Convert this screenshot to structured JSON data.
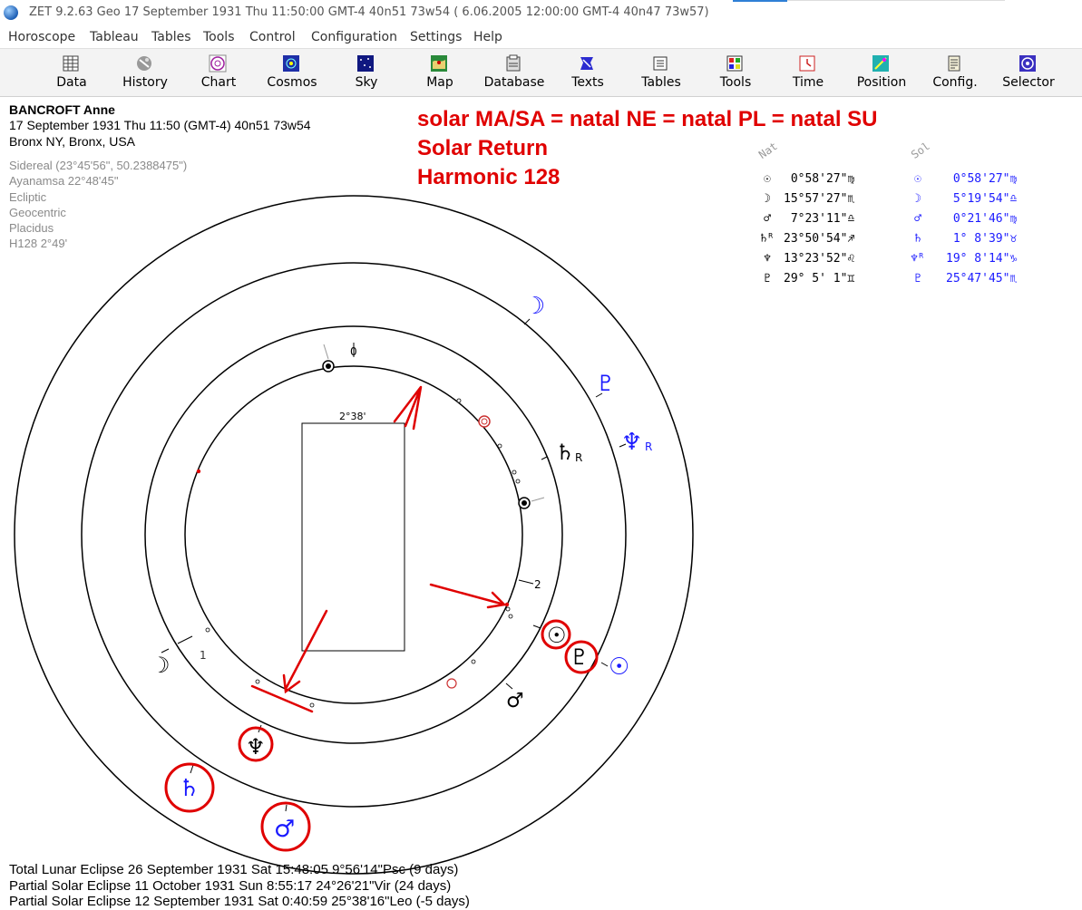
{
  "window": {
    "title": "ZET 9.2.63 Geo    17 September 1931  Thu  11:50:00 GMT-4 40n51  73w54   ( 6.06.2005  12:00:00 GMT-4 40n47 73w57)"
  },
  "menu": [
    "Horoscope",
    "Tableau",
    "Tables",
    "Tools",
    "Control",
    "Configuration",
    "Settings",
    "Help"
  ],
  "toolbar": [
    {
      "label": "Data",
      "icon": "data-grid-icon"
    },
    {
      "label": "History",
      "icon": "history-icon"
    },
    {
      "label": "Chart",
      "icon": "chart-wheel-icon"
    },
    {
      "label": "Cosmos",
      "icon": "cosmos-icon"
    },
    {
      "label": "Sky",
      "icon": "sky-icon"
    },
    {
      "label": "Map",
      "icon": "map-icon"
    },
    {
      "label": "Database",
      "icon": "database-icon"
    },
    {
      "label": "Texts",
      "icon": "texts-icon"
    },
    {
      "label": "Tables",
      "icon": "tables-icon"
    },
    {
      "label": "Tools",
      "icon": "tools-icon"
    },
    {
      "label": "Time",
      "icon": "time-icon"
    },
    {
      "label": "Position",
      "icon": "position-icon"
    },
    {
      "label": "Config.",
      "icon": "config-icon"
    },
    {
      "label": "Selector",
      "icon": "selector-icon"
    }
  ],
  "person": {
    "name": "BANCROFT Anne",
    "datetime": "17 September 1931  Thu  11:50 (GMT-4) 40n51  73w54",
    "place": "Bronx NY, Bronx, USA"
  },
  "settings": [
    "Sidereal (23°45'56\", 50.2388475\")",
    "Ayanamsa 22°48'45\"",
    "Ecliptic",
    "Geocentric",
    "Placidus",
    "H128   2°49'"
  ],
  "annotation": [
    "solar MA/SA = natal NE = natal PL = natal SU",
    "Solar Return",
    "Harmonic 128"
  ],
  "table": {
    "nat_header": "Nat",
    "sol_header": "Sol",
    "rows": [
      {
        "nat_glyph": "☉",
        "nat_value": " 0°58'27\"♍",
        "sol_glyph": "☉",
        "sol_value": " 0°58'27\"♍"
      },
      {
        "nat_glyph": "☽",
        "nat_value": "15°57'27\"♏",
        "sol_glyph": "☽",
        "sol_value": " 5°19'54\"♎"
      },
      {
        "nat_glyph": "♂",
        "nat_value": " 7°23'11\"♎",
        "sol_glyph": "♂",
        "sol_value": " 0°21'46\"♍"
      },
      {
        "nat_glyph": "♄ᴿ",
        "nat_value": "23°50'54\"♐",
        "sol_glyph": "♄",
        "sol_value": " 1° 8'39\"♉"
      },
      {
        "nat_glyph": "♆",
        "nat_value": "13°23'52\"♌",
        "sol_glyph": "♆ᴿ",
        "sol_value": "19° 8'14\"♑"
      },
      {
        "nat_glyph": "♇",
        "nat_value": "29° 5' 1\"♊",
        "sol_glyph": "♇",
        "sol_value": "25°47'45\"♏"
      }
    ]
  },
  "wheel": {
    "box_label": "2°38'",
    "house_labels": [
      "0",
      "1",
      "2"
    ],
    "natal_planets": [
      {
        "name": "moon",
        "glyph": "☽"
      },
      {
        "name": "mars",
        "glyph": "♂"
      },
      {
        "name": "saturn",
        "glyph": "♄"
      },
      {
        "name": "neptune",
        "glyph": "♆"
      },
      {
        "name": "pluto",
        "glyph": "♇"
      },
      {
        "name": "sun",
        "glyph": "☉"
      }
    ],
    "solar_planets": [
      {
        "name": "moon",
        "glyph": "☽"
      },
      {
        "name": "pluto",
        "glyph": "♇"
      },
      {
        "name": "neptune",
        "glyph": "♆"
      },
      {
        "name": "sun",
        "glyph": "☉"
      },
      {
        "name": "saturn",
        "glyph": "♄"
      },
      {
        "name": "mars",
        "glyph": "♂"
      }
    ],
    "retrograde_mark": "R",
    "colors": {
      "natal": "#000000",
      "solar": "#1a1aff",
      "annotation": "#e00000"
    }
  },
  "eclipses": [
    "Total Lunar Eclipse 26 September 1931 Sat 15:48:05  9°56'14\"Psc (9 days)",
    "Partial Solar Eclipse 11 October 1931 Sun  8:55:17 24°26'21\"Vir (24 days)",
    "Partial Solar Eclipse 12 September 1931 Sat  0:40:59 25°38'16\"Leo (-5 days)"
  ]
}
